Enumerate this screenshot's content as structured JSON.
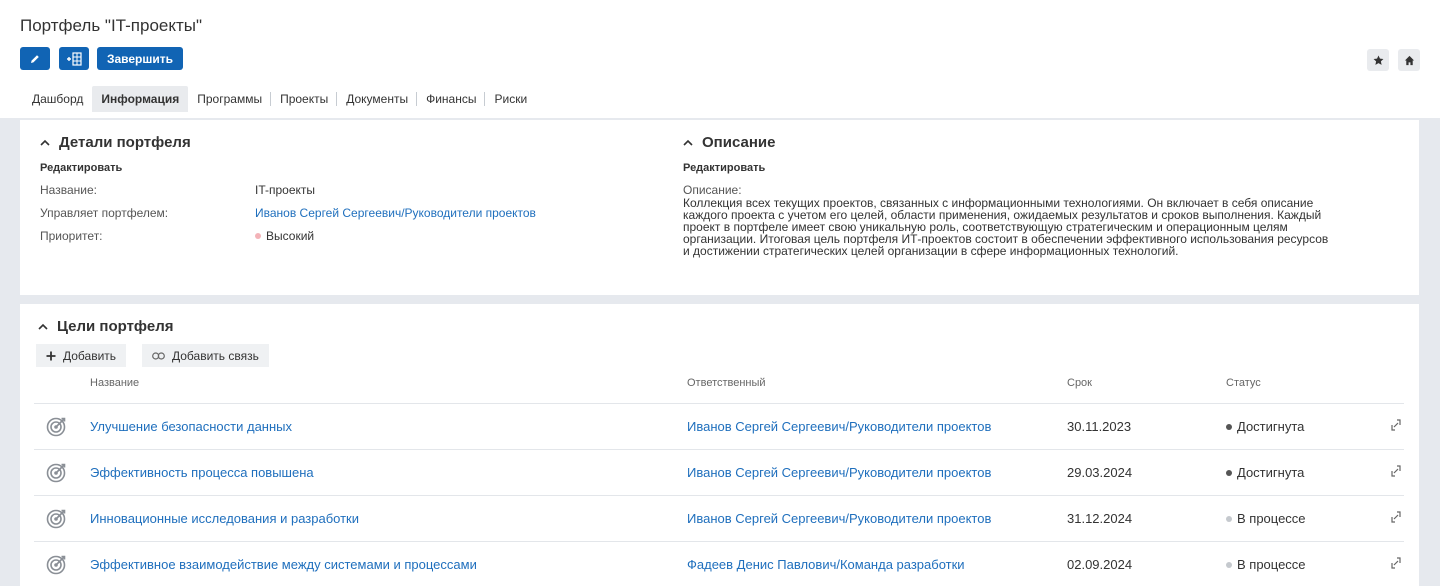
{
  "page": {
    "title": "Портфель \"IT-проекты\"",
    "finish_label": "Завершить",
    "colors": {
      "primary": "#1164b4",
      "link": "#1f6fbd",
      "priority_high": "#f3b3b8",
      "status_done": "#555555",
      "status_progress": "#c5c9ce"
    }
  },
  "icons": {
    "edit": "pencil-icon",
    "add_child": "add-structure-icon",
    "star": "star-icon",
    "home": "home-icon"
  },
  "tabs": [
    {
      "label": "Дашборд"
    },
    {
      "label": "Информация",
      "active": true
    },
    {
      "label": "Программы"
    },
    {
      "label": "Проекты"
    },
    {
      "label": "Документы"
    },
    {
      "label": "Финансы"
    },
    {
      "label": "Риски"
    }
  ],
  "details": {
    "title": "Детали портфеля",
    "edit_label": "Редактировать",
    "fields": [
      {
        "label": "Название:",
        "value": "IT-проекты"
      },
      {
        "label": "Управляет портфелем:",
        "value": "Иванов Сергей Сергеевич/Руководители проектов"
      },
      {
        "label": "Приоритет:",
        "value": "Высокий"
      }
    ]
  },
  "description": {
    "title": "Описание",
    "edit_label": "Редактировать",
    "label": "Описание:",
    "lines": [
      "Коллекция всех текущих проектов, связанных с информационными технологиями. Он включает в себя описание",
      "каждого проекта с учетом его целей, области применения, ожидаемых результатов и сроков выполнения. Каждый",
      "проект в портфеле имеет свою уникальную роль, соответствующую стратегическим и операционным целям",
      "организации. Итоговая цель портфеля ИТ-проектов состоит в обеспечении эффективного использования ресурсов",
      "и достижении стратегических целей организации в сфере информационных технологий."
    ]
  },
  "goals": {
    "title": "Цели портфеля",
    "add_label": "Добавить",
    "add_link_label": "Добавить связь",
    "columns": {
      "name": "Название",
      "owner": "Ответственный",
      "due": "Срок",
      "status": "Статус"
    },
    "rows": [
      {
        "name": "Улучшение безопасности данных",
        "owner": "Иванов Сергей Сергеевич/Руководители проектов",
        "due": "30.11.2023",
        "status": "Достигнута",
        "done": true
      },
      {
        "name": "Эффективность процесса повышена",
        "owner": "Иванов Сергей Сергеевич/Руководители проектов",
        "due": "29.03.2024",
        "status": "Достигнута",
        "done": true
      },
      {
        "name": "Инновационные исследования и разработки",
        "owner": "Иванов Сергей Сергеевич/Руководители проектов",
        "due": "31.12.2024",
        "status": "В процессе",
        "done": false
      },
      {
        "name": "Эффективное взаимодействие между системами и процессами",
        "owner": "Фадеев Денис Павлович/Команда разработки",
        "due": "02.09.2024",
        "status": "В процессе",
        "done": false
      }
    ]
  }
}
